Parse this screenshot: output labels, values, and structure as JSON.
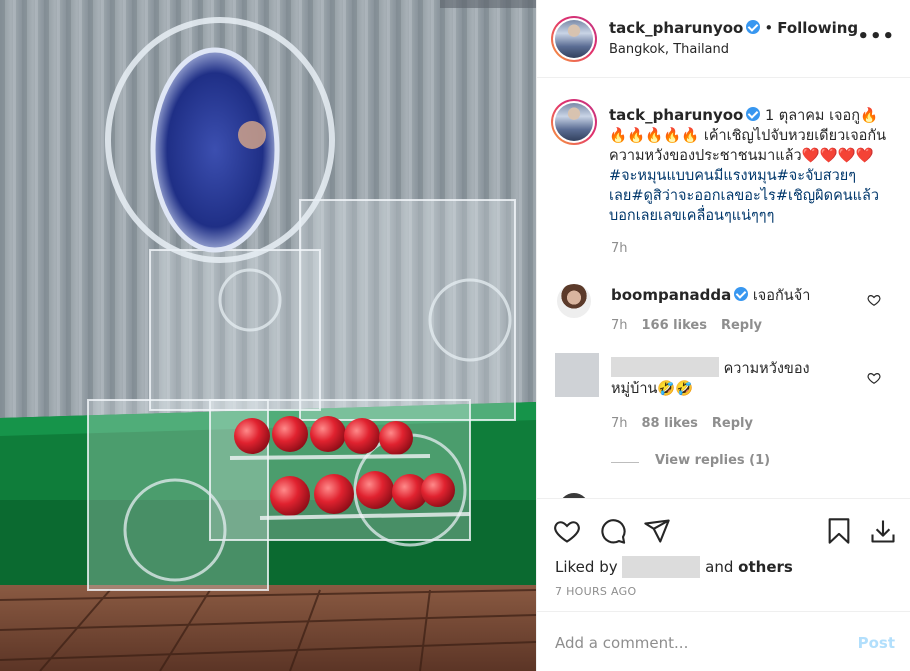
{
  "post": {
    "username": "tack_pharunyoo",
    "follow_status": "Following",
    "location": "Bangkok, Thailand",
    "more_label": "•••"
  },
  "caption": {
    "username": "tack_pharunyoo",
    "text_1": "1 ตุลาคม เจอกู🔥🔥🔥🔥🔥🔥 เค้าเชิญไปจับหวยเดียวเจอกัน ความหวังของประชาชนมาแล้ว❤️❤️❤️❤️",
    "hashtags": "#จะหมุนแบบคนมีแรงหมุน#จะจับสวยๆเลย#ดูสิว่าจะออกเลขอะไร#เชิญผิดคนแล้วบอกเลยเลขเคลื่อนๆแน่ๆๆๆ",
    "time": "7h"
  },
  "comments": [
    {
      "username": "boompanadda",
      "text": "เจอกันจ้า",
      "time": "7h",
      "likes": "166 likes",
      "reply": "Reply"
    },
    {
      "username": "",
      "text_a": "ความหวังของ",
      "text_b": "หมู่บ้าน🤣🤣",
      "time": "7h",
      "likes": "88 likes",
      "reply": "Reply",
      "view_replies": "View replies (1)"
    }
  ],
  "liked_by": {
    "prefix": "Liked by",
    "middle": "and",
    "others": "others"
  },
  "timestamp": "7 HOURS AGO",
  "add_comment": {
    "placeholder": "Add a comment...",
    "post_label": "Post"
  },
  "icons": [
    "heart-icon",
    "comment-icon",
    "share-icon",
    "bookmark-icon",
    "download-icon",
    "verified-badge-icon",
    "more-options-icon"
  ],
  "colors": {
    "link_blue": "#00376b",
    "verified_blue": "#3897f0",
    "post_button": "#b2dffc",
    "muted_text": "#8e8e8e"
  }
}
